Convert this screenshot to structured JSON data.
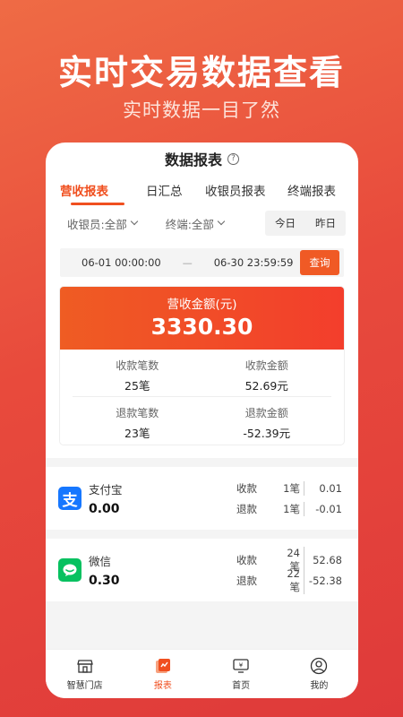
{
  "hero": {
    "title": "实时交易数据查看",
    "subtitle": "实时数据一目了然"
  },
  "header": {
    "title": "数据报表",
    "help_icon": "question-circle-icon"
  },
  "tabs": [
    {
      "label": "营收报表",
      "active": true
    },
    {
      "label": "日汇总",
      "active": false
    },
    {
      "label": "收银员报表",
      "active": false
    },
    {
      "label": "终端报表",
      "active": false
    }
  ],
  "filters": {
    "cashier": "收银员:全部",
    "terminal": "终端:全部",
    "today": "今日",
    "yesterday": "昨日"
  },
  "date_range": {
    "start": "06-01 00:00:00",
    "separator": "—",
    "end": "06-30 23:59:59",
    "query_label": "查询"
  },
  "summary": {
    "label": "营收金额(元)",
    "value": "3330.30",
    "stats": [
      {
        "label": "收款笔数",
        "value": "25笔"
      },
      {
        "label": "收款金额",
        "value": "52.69元"
      },
      {
        "label": "退款笔数",
        "value": "23笔"
      },
      {
        "label": "退款金额",
        "value": "-52.39元"
      }
    ]
  },
  "payments": [
    {
      "name": "支付宝",
      "icon": "alipay-icon",
      "total": "0.00",
      "receive_label": "收款",
      "receive_count": "1笔",
      "receive_amount": "0.01",
      "refund_label": "退款",
      "refund_count": "1笔",
      "refund_amount": "-0.01"
    },
    {
      "name": "微信",
      "icon": "wechat-icon",
      "total": "0.30",
      "receive_label": "收款",
      "receive_count": "24笔",
      "receive_amount": "52.68",
      "refund_label": "退款",
      "refund_count": "22笔",
      "refund_amount": "-52.38"
    }
  ],
  "bottom_nav": [
    {
      "label": "智慧门店",
      "icon": "store-icon",
      "active": false
    },
    {
      "label": "报表",
      "icon": "report-icon",
      "active": true
    },
    {
      "label": "首页",
      "icon": "home-yen-icon",
      "active": false
    },
    {
      "label": "我的",
      "icon": "profile-icon",
      "active": false
    }
  ],
  "colors": {
    "accent": "#f04f1f",
    "alipay": "#1677ff",
    "wechat": "#07c160"
  }
}
